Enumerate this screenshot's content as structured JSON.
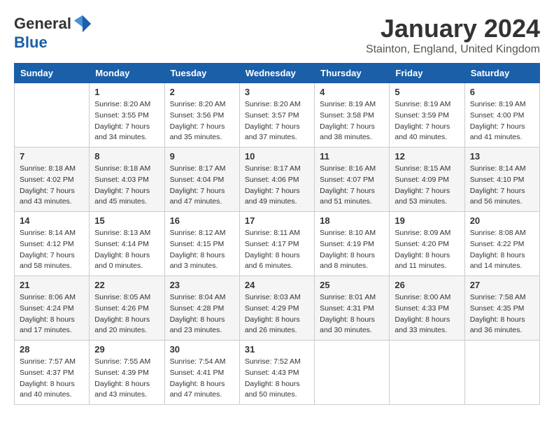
{
  "logo": {
    "general": "General",
    "blue": "Blue"
  },
  "title": {
    "month_year": "January 2024",
    "location": "Stainton, England, United Kingdom"
  },
  "days_of_week": [
    "Sunday",
    "Monday",
    "Tuesday",
    "Wednesday",
    "Thursday",
    "Friday",
    "Saturday"
  ],
  "weeks": [
    [
      {
        "day": "",
        "info": ""
      },
      {
        "day": "1",
        "info": "Sunrise: 8:20 AM\nSunset: 3:55 PM\nDaylight: 7 hours\nand 34 minutes."
      },
      {
        "day": "2",
        "info": "Sunrise: 8:20 AM\nSunset: 3:56 PM\nDaylight: 7 hours\nand 35 minutes."
      },
      {
        "day": "3",
        "info": "Sunrise: 8:20 AM\nSunset: 3:57 PM\nDaylight: 7 hours\nand 37 minutes."
      },
      {
        "day": "4",
        "info": "Sunrise: 8:19 AM\nSunset: 3:58 PM\nDaylight: 7 hours\nand 38 minutes."
      },
      {
        "day": "5",
        "info": "Sunrise: 8:19 AM\nSunset: 3:59 PM\nDaylight: 7 hours\nand 40 minutes."
      },
      {
        "day": "6",
        "info": "Sunrise: 8:19 AM\nSunset: 4:00 PM\nDaylight: 7 hours\nand 41 minutes."
      }
    ],
    [
      {
        "day": "7",
        "info": "Sunrise: 8:18 AM\nSunset: 4:02 PM\nDaylight: 7 hours\nand 43 minutes."
      },
      {
        "day": "8",
        "info": "Sunrise: 8:18 AM\nSunset: 4:03 PM\nDaylight: 7 hours\nand 45 minutes."
      },
      {
        "day": "9",
        "info": "Sunrise: 8:17 AM\nSunset: 4:04 PM\nDaylight: 7 hours\nand 47 minutes."
      },
      {
        "day": "10",
        "info": "Sunrise: 8:17 AM\nSunset: 4:06 PM\nDaylight: 7 hours\nand 49 minutes."
      },
      {
        "day": "11",
        "info": "Sunrise: 8:16 AM\nSunset: 4:07 PM\nDaylight: 7 hours\nand 51 minutes."
      },
      {
        "day": "12",
        "info": "Sunrise: 8:15 AM\nSunset: 4:09 PM\nDaylight: 7 hours\nand 53 minutes."
      },
      {
        "day": "13",
        "info": "Sunrise: 8:14 AM\nSunset: 4:10 PM\nDaylight: 7 hours\nand 56 minutes."
      }
    ],
    [
      {
        "day": "14",
        "info": "Sunrise: 8:14 AM\nSunset: 4:12 PM\nDaylight: 7 hours\nand 58 minutes."
      },
      {
        "day": "15",
        "info": "Sunrise: 8:13 AM\nSunset: 4:14 PM\nDaylight: 8 hours\nand 0 minutes."
      },
      {
        "day": "16",
        "info": "Sunrise: 8:12 AM\nSunset: 4:15 PM\nDaylight: 8 hours\nand 3 minutes."
      },
      {
        "day": "17",
        "info": "Sunrise: 8:11 AM\nSunset: 4:17 PM\nDaylight: 8 hours\nand 6 minutes."
      },
      {
        "day": "18",
        "info": "Sunrise: 8:10 AM\nSunset: 4:19 PM\nDaylight: 8 hours\nand 8 minutes."
      },
      {
        "day": "19",
        "info": "Sunrise: 8:09 AM\nSunset: 4:20 PM\nDaylight: 8 hours\nand 11 minutes."
      },
      {
        "day": "20",
        "info": "Sunrise: 8:08 AM\nSunset: 4:22 PM\nDaylight: 8 hours\nand 14 minutes."
      }
    ],
    [
      {
        "day": "21",
        "info": "Sunrise: 8:06 AM\nSunset: 4:24 PM\nDaylight: 8 hours\nand 17 minutes."
      },
      {
        "day": "22",
        "info": "Sunrise: 8:05 AM\nSunset: 4:26 PM\nDaylight: 8 hours\nand 20 minutes."
      },
      {
        "day": "23",
        "info": "Sunrise: 8:04 AM\nSunset: 4:28 PM\nDaylight: 8 hours\nand 23 minutes."
      },
      {
        "day": "24",
        "info": "Sunrise: 8:03 AM\nSunset: 4:29 PM\nDaylight: 8 hours\nand 26 minutes."
      },
      {
        "day": "25",
        "info": "Sunrise: 8:01 AM\nSunset: 4:31 PM\nDaylight: 8 hours\nand 30 minutes."
      },
      {
        "day": "26",
        "info": "Sunrise: 8:00 AM\nSunset: 4:33 PM\nDaylight: 8 hours\nand 33 minutes."
      },
      {
        "day": "27",
        "info": "Sunrise: 7:58 AM\nSunset: 4:35 PM\nDaylight: 8 hours\nand 36 minutes."
      }
    ],
    [
      {
        "day": "28",
        "info": "Sunrise: 7:57 AM\nSunset: 4:37 PM\nDaylight: 8 hours\nand 40 minutes."
      },
      {
        "day": "29",
        "info": "Sunrise: 7:55 AM\nSunset: 4:39 PM\nDaylight: 8 hours\nand 43 minutes."
      },
      {
        "day": "30",
        "info": "Sunrise: 7:54 AM\nSunset: 4:41 PM\nDaylight: 8 hours\nand 47 minutes."
      },
      {
        "day": "31",
        "info": "Sunrise: 7:52 AM\nSunset: 4:43 PM\nDaylight: 8 hours\nand 50 minutes."
      },
      {
        "day": "",
        "info": ""
      },
      {
        "day": "",
        "info": ""
      },
      {
        "day": "",
        "info": ""
      }
    ]
  ]
}
